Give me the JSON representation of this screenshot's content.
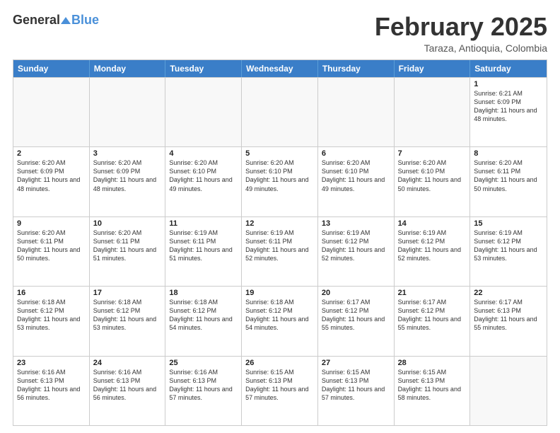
{
  "header": {
    "logo_general": "General",
    "logo_blue": "Blue",
    "month_year": "February 2025",
    "location": "Taraza, Antioquia, Colombia"
  },
  "calendar": {
    "days_of_week": [
      "Sunday",
      "Monday",
      "Tuesday",
      "Wednesday",
      "Thursday",
      "Friday",
      "Saturday"
    ],
    "weeks": [
      [
        {
          "day": "",
          "info": ""
        },
        {
          "day": "",
          "info": ""
        },
        {
          "day": "",
          "info": ""
        },
        {
          "day": "",
          "info": ""
        },
        {
          "day": "",
          "info": ""
        },
        {
          "day": "",
          "info": ""
        },
        {
          "day": "1",
          "info": "Sunrise: 6:21 AM\nSunset: 6:09 PM\nDaylight: 11 hours and 48 minutes."
        }
      ],
      [
        {
          "day": "2",
          "info": "Sunrise: 6:20 AM\nSunset: 6:09 PM\nDaylight: 11 hours and 48 minutes."
        },
        {
          "day": "3",
          "info": "Sunrise: 6:20 AM\nSunset: 6:09 PM\nDaylight: 11 hours and 48 minutes."
        },
        {
          "day": "4",
          "info": "Sunrise: 6:20 AM\nSunset: 6:10 PM\nDaylight: 11 hours and 49 minutes."
        },
        {
          "day": "5",
          "info": "Sunrise: 6:20 AM\nSunset: 6:10 PM\nDaylight: 11 hours and 49 minutes."
        },
        {
          "day": "6",
          "info": "Sunrise: 6:20 AM\nSunset: 6:10 PM\nDaylight: 11 hours and 49 minutes."
        },
        {
          "day": "7",
          "info": "Sunrise: 6:20 AM\nSunset: 6:10 PM\nDaylight: 11 hours and 50 minutes."
        },
        {
          "day": "8",
          "info": "Sunrise: 6:20 AM\nSunset: 6:11 PM\nDaylight: 11 hours and 50 minutes."
        }
      ],
      [
        {
          "day": "9",
          "info": "Sunrise: 6:20 AM\nSunset: 6:11 PM\nDaylight: 11 hours and 50 minutes."
        },
        {
          "day": "10",
          "info": "Sunrise: 6:20 AM\nSunset: 6:11 PM\nDaylight: 11 hours and 51 minutes."
        },
        {
          "day": "11",
          "info": "Sunrise: 6:19 AM\nSunset: 6:11 PM\nDaylight: 11 hours and 51 minutes."
        },
        {
          "day": "12",
          "info": "Sunrise: 6:19 AM\nSunset: 6:11 PM\nDaylight: 11 hours and 52 minutes."
        },
        {
          "day": "13",
          "info": "Sunrise: 6:19 AM\nSunset: 6:12 PM\nDaylight: 11 hours and 52 minutes."
        },
        {
          "day": "14",
          "info": "Sunrise: 6:19 AM\nSunset: 6:12 PM\nDaylight: 11 hours and 52 minutes."
        },
        {
          "day": "15",
          "info": "Sunrise: 6:19 AM\nSunset: 6:12 PM\nDaylight: 11 hours and 53 minutes."
        }
      ],
      [
        {
          "day": "16",
          "info": "Sunrise: 6:18 AM\nSunset: 6:12 PM\nDaylight: 11 hours and 53 minutes."
        },
        {
          "day": "17",
          "info": "Sunrise: 6:18 AM\nSunset: 6:12 PM\nDaylight: 11 hours and 53 minutes."
        },
        {
          "day": "18",
          "info": "Sunrise: 6:18 AM\nSunset: 6:12 PM\nDaylight: 11 hours and 54 minutes."
        },
        {
          "day": "19",
          "info": "Sunrise: 6:18 AM\nSunset: 6:12 PM\nDaylight: 11 hours and 54 minutes."
        },
        {
          "day": "20",
          "info": "Sunrise: 6:17 AM\nSunset: 6:12 PM\nDaylight: 11 hours and 55 minutes."
        },
        {
          "day": "21",
          "info": "Sunrise: 6:17 AM\nSunset: 6:12 PM\nDaylight: 11 hours and 55 minutes."
        },
        {
          "day": "22",
          "info": "Sunrise: 6:17 AM\nSunset: 6:13 PM\nDaylight: 11 hours and 55 minutes."
        }
      ],
      [
        {
          "day": "23",
          "info": "Sunrise: 6:16 AM\nSunset: 6:13 PM\nDaylight: 11 hours and 56 minutes."
        },
        {
          "day": "24",
          "info": "Sunrise: 6:16 AM\nSunset: 6:13 PM\nDaylight: 11 hours and 56 minutes."
        },
        {
          "day": "25",
          "info": "Sunrise: 6:16 AM\nSunset: 6:13 PM\nDaylight: 11 hours and 57 minutes."
        },
        {
          "day": "26",
          "info": "Sunrise: 6:15 AM\nSunset: 6:13 PM\nDaylight: 11 hours and 57 minutes."
        },
        {
          "day": "27",
          "info": "Sunrise: 6:15 AM\nSunset: 6:13 PM\nDaylight: 11 hours and 57 minutes."
        },
        {
          "day": "28",
          "info": "Sunrise: 6:15 AM\nSunset: 6:13 PM\nDaylight: 11 hours and 58 minutes."
        },
        {
          "day": "",
          "info": ""
        }
      ]
    ]
  }
}
